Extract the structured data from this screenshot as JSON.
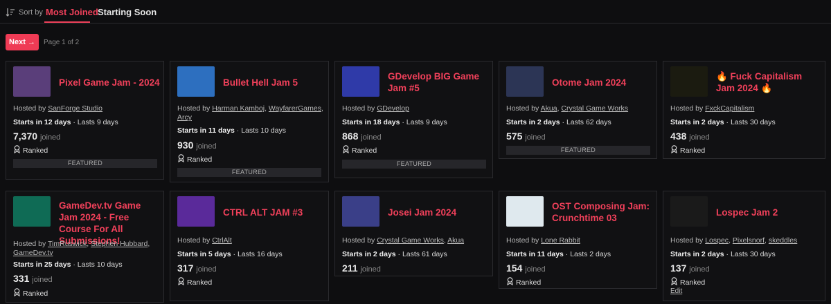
{
  "sortbar": {
    "label": "Sort by",
    "options": [
      "Most Joined",
      "Starting Soon"
    ],
    "active": "Most Joined"
  },
  "pagination": {
    "next_label": "Next →",
    "page_info": "Page 1 of 2"
  },
  "ranked_label": "Ranked",
  "featured_label": "FEATURED",
  "joined_label": "joined",
  "hosted_prefix": "Hosted by",
  "cards": [
    {
      "title": "Pixel Game Jam - 2024",
      "hosts": [
        "SanForge Studio"
      ],
      "starts": "Starts in 12 days",
      "lasts": "Lasts 9 days",
      "joined": "7,370",
      "featured": true,
      "thumb_color": "#5a3e7a"
    },
    {
      "title": "Bullet Hell Jam 5",
      "hosts": [
        "Harman Kamboj",
        "WayfarerGames",
        "Arcy"
      ],
      "starts": "Starts in 11 days",
      "lasts": "Lasts 10 days",
      "joined": "930",
      "featured": true,
      "thumb_color": "#2d6fbf"
    },
    {
      "title": "GDevelop BIG Game Jam #5",
      "hosts": [
        "GDevelop"
      ],
      "starts": "Starts in 18 days",
      "lasts": "Lasts 9 days",
      "joined": "868",
      "featured": true,
      "thumb_color": "#2f3aa8"
    },
    {
      "title": "Otome Jam 2024",
      "hosts": [
        "Akua",
        "Crystal Game Works"
      ],
      "starts": "Starts in 2 days",
      "lasts": "Lasts 62 days",
      "joined": "575",
      "featured": true,
      "thumb_color": "#2c3555"
    },
    {
      "title": "🔥 Fuck Capitalism Jam 2024 🔥",
      "hosts": [
        "FxckCapitalism"
      ],
      "starts": "Starts in 2 days",
      "lasts": "Lasts 30 days",
      "joined": "438",
      "featured": false,
      "thumb_color": "#1b1b10"
    },
    {
      "title": "GameDev.tv Game Jam 2024 - Free Course For All Submissions!",
      "hosts": [
        "TimRuswick",
        "Stephen Hubbard",
        "GameDev.tv"
      ],
      "starts": "Starts in 25 days",
      "lasts": "Lasts 10 days",
      "joined": "331",
      "featured": false,
      "thumb_color": "#0f6b55"
    },
    {
      "title": "CTRL ALT JAM #3",
      "hosts": [
        "CtrlAlt"
      ],
      "starts": "Starts in 5 days",
      "lasts": "Lasts 16 days",
      "joined": "317",
      "featured": false,
      "thumb_color": "#5a2a9a"
    },
    {
      "title": "Josei Jam 2024",
      "hosts": [
        "Crystal Game Works",
        "Akua"
      ],
      "starts": "Starts in 2 days",
      "lasts": "Lasts 61 days",
      "joined": "211",
      "featured": false,
      "thumb_color": "#3a3f88"
    },
    {
      "title": "OST Composing Jam: Crunchtime 03",
      "hosts": [
        "Lone Rabbit"
      ],
      "starts": "Starts in 11 days",
      "lasts": "Lasts 2 days",
      "joined": "154",
      "featured": false,
      "thumb_color": "#dfe9ee"
    },
    {
      "title": "Lospec Jam 2",
      "hosts": [
        "Lospec",
        "Pixelsnorf",
        "skeddles"
      ],
      "starts": "Starts in 2 days",
      "lasts": "Lasts 30 days",
      "joined": "137",
      "featured": false,
      "thumb_color": "#1a1a1a",
      "edit": "Edit"
    }
  ]
}
